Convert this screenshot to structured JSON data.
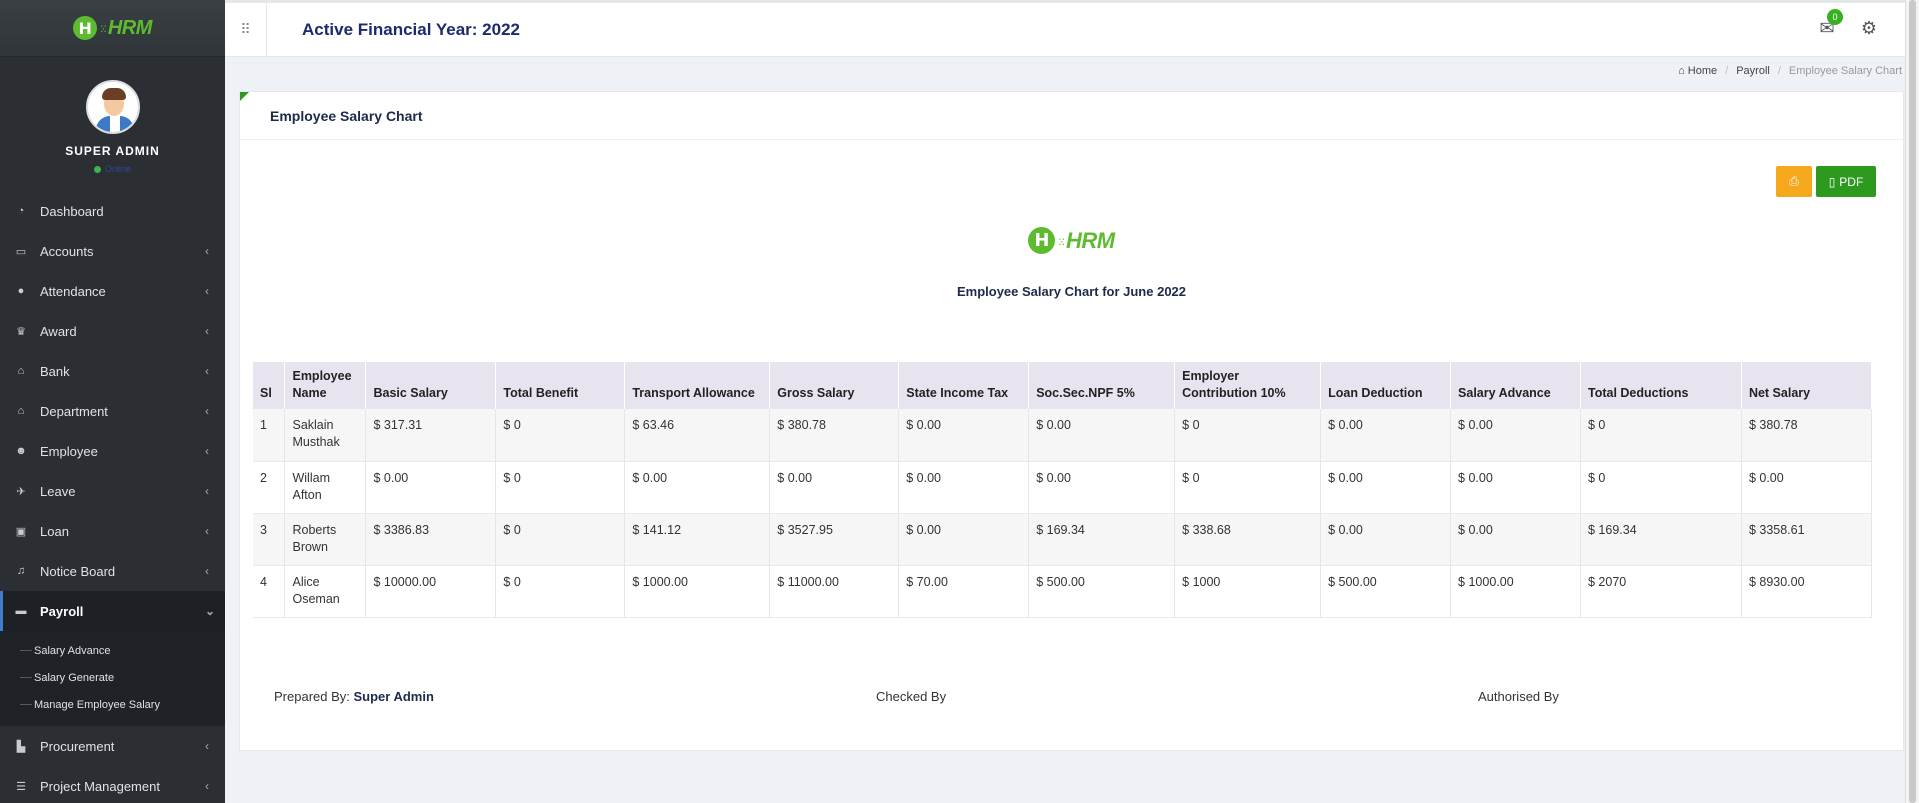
{
  "app": {
    "logo_text": "HRM",
    "logo_letter": "H"
  },
  "sidebar": {
    "user_name": "SUPER ADMIN",
    "user_status": "Online",
    "items": [
      {
        "label": "Dashboard",
        "icon": "dashboard-icon",
        "glyph": "◔",
        "chevron": ""
      },
      {
        "label": "Accounts",
        "icon": "briefcase-icon",
        "glyph": "▭",
        "chevron": "‹"
      },
      {
        "label": "Attendance",
        "icon": "user-icon",
        "glyph": "●",
        "chevron": "‹"
      },
      {
        "label": "Award",
        "icon": "trophy-icon",
        "glyph": "♛",
        "chevron": "‹"
      },
      {
        "label": "Bank",
        "icon": "bank-icon",
        "glyph": "⌂",
        "chevron": "‹"
      },
      {
        "label": "Department",
        "icon": "building-icon",
        "glyph": "⌂",
        "chevron": "‹"
      },
      {
        "label": "Employee",
        "icon": "users-icon",
        "glyph": "☻",
        "chevron": "‹"
      },
      {
        "label": "Leave",
        "icon": "plane-icon",
        "glyph": "✈",
        "chevron": "‹"
      },
      {
        "label": "Loan",
        "icon": "money-icon",
        "glyph": "▣",
        "chevron": "‹"
      },
      {
        "label": "Notice Board",
        "icon": "bell-icon",
        "glyph": "♫",
        "chevron": "‹"
      },
      {
        "label": "Payroll",
        "icon": "credit-card-icon",
        "glyph": "▬",
        "chevron": "⌄"
      },
      {
        "label": "Procurement",
        "icon": "industry-icon",
        "glyph": "▙",
        "chevron": "‹"
      },
      {
        "label": "Project Management",
        "icon": "list-icon",
        "glyph": "☰",
        "chevron": "‹"
      }
    ],
    "payroll_submenu": [
      "Salary Advance",
      "Salary Generate",
      "Manage Employee Salary"
    ]
  },
  "header": {
    "title": "Active Financial Year: 2022",
    "notification_count": "0"
  },
  "breadcrumb": {
    "home": "Home",
    "section": "Payroll",
    "current": "Employee Salary Chart"
  },
  "panel": {
    "title": "Employee Salary Chart",
    "print_icon": "print-icon",
    "pdf_label": "PDF",
    "report_title": "Employee Salary Chart for June 2022"
  },
  "table": {
    "headers": [
      "Sl",
      "Employee Name",
      "Basic Salary",
      "Total Benefit",
      "Transport Allowance",
      "Gross Salary",
      "State Income Tax",
      "Soc.Sec.NPF 5%",
      "Employer Contribution 10%",
      "Loan Deduction",
      "Salary Advance",
      "Total Deductions",
      "Net Salary"
    ],
    "rows": [
      [
        "1",
        "Saklain Musthak",
        "$ 317.31",
        "$ 0",
        "$ 63.46",
        "$ 380.78",
        "$ 0.00",
        "$ 0.00",
        "$ 0",
        "$ 0.00",
        "$ 0.00",
        "$ 0",
        "$ 380.78"
      ],
      [
        "2",
        "Willam Afton",
        "$ 0.00",
        "$ 0",
        "$ 0.00",
        "$ 0.00",
        "$ 0.00",
        "$ 0.00",
        "$ 0",
        "$ 0.00",
        "$ 0.00",
        "$ 0",
        "$ 0.00"
      ],
      [
        "3",
        "Roberts Brown",
        "$ 3386.83",
        "$ 0",
        "$ 141.12",
        "$ 3527.95",
        "$ 0.00",
        "$ 169.34",
        "$ 338.68",
        "$ 0.00",
        "$ 0.00",
        "$ 169.34",
        "$ 3358.61"
      ],
      [
        "4",
        "Alice Oseman",
        "$ 10000.00",
        "$ 0",
        "$ 1000.00",
        "$ 11000.00",
        "$ 70.00",
        "$ 500.00",
        "$ 1000",
        "$ 500.00",
        "$ 1000.00",
        "$ 2070",
        "$ 8930.00"
      ]
    ]
  },
  "signatures": {
    "prepared_label": "Prepared By:",
    "prepared_name": "Super Admin",
    "checked": "Checked By",
    "authorised": "Authorised By"
  },
  "colors": {
    "brand_green": "#5dbb2f",
    "sidebar_bg": "#2b2f33",
    "print_button": "#f6a81d",
    "pdf_button": "#2d9a1f",
    "title_navy": "#1d2a6b"
  }
}
